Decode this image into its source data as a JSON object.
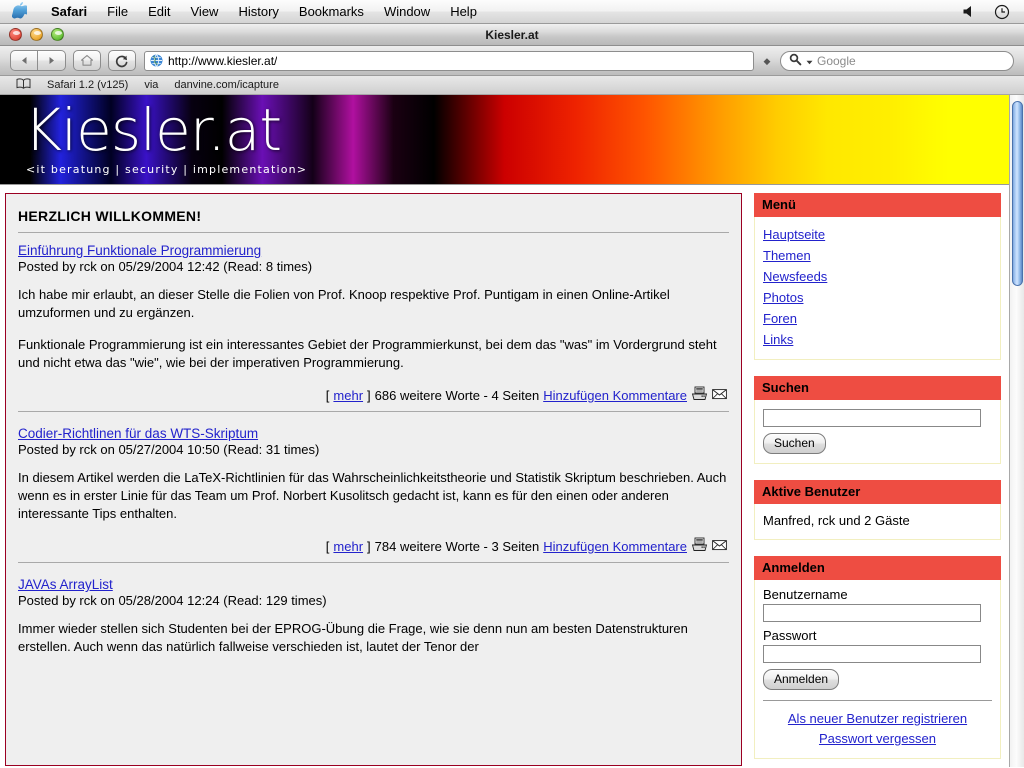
{
  "menubar": {
    "apple_icon": "apple-logo-icon",
    "items": [
      "Safari",
      "File",
      "Edit",
      "View",
      "History",
      "Bookmarks",
      "Window",
      "Help"
    ],
    "right_icons": [
      "volume-icon",
      "clock-icon"
    ]
  },
  "window": {
    "title": "Kiesler.at"
  },
  "toolbar": {
    "back_icon": "back-arrow-icon",
    "forward_icon": "forward-arrow-icon",
    "home_icon": "home-icon",
    "reload_icon": "reload-icon",
    "favicon": "globe-icon",
    "url": "http://www.kiesler.at/",
    "snapback_icon": "snapback-icon",
    "search_icon": "magnifier-icon",
    "search_placeholder": "Google"
  },
  "bookmarks_bar": {
    "book_icon": "book-icon",
    "items": [
      "Safari 1.2 (v125)",
      "via",
      "danvine.com/icapture"
    ]
  },
  "banner": {
    "logo": "Kiesler.at",
    "tagline": "<it beratung | security | implementation>"
  },
  "content": {
    "heading": "HERZLICH WILLKOMMEN!",
    "articles": [
      {
        "title": "Einführung Funktionale Programmierung",
        "meta": "Posted by rck on 05/29/2004 12:42 (Read: 8 times)",
        "para1": "Ich habe mir erlaubt, an dieser Stelle die Folien von Prof. Knoop respektive Prof. Puntigam in einen Online-Artikel umzuformen und zu ergänzen.",
        "para2": "Funktionale Programmierung ist ein interessantes Gebiet der Programmierkunst, bei dem das \"was\" im Vordergrund steht und nicht etwa das \"wie\", wie bei der imperativen Programmierung.",
        "more_label": "mehr",
        "more_text": "686 weitere Worte - 4 Seiten",
        "comments_label": "Hinzufügen Kommentare",
        "print_icon": "printer-icon",
        "mail_icon": "envelope-icon"
      },
      {
        "title": "Codier-Richtlinen für das WTS-Skriptum",
        "meta": "Posted by rck on 05/27/2004 10:50 (Read: 31 times)",
        "para1": "In diesem Artikel werden die LaTeX-Richtlinien für das Wahrscheinlichkeitstheorie und Statistik Skriptum beschrieben. Auch wenn es in erster Linie für das Team um Prof. Norbert Kusolitsch gedacht ist, kann es für den einen oder anderen interessante Tips enthalten.",
        "more_label": "mehr",
        "more_text": "784 weitere Worte - 3 Seiten",
        "comments_label": "Hinzufügen Kommentare",
        "print_icon": "printer-icon",
        "mail_icon": "envelope-icon"
      },
      {
        "title": "JAVAs ArrayList",
        "meta": "Posted by rck on 05/28/2004 12:24 (Read: 129 times)",
        "para1": "Immer wieder stellen sich Studenten bei der EPROG-Übung die Frage, wie sie denn nun am besten Datenstrukturen erstellen. Auch wenn das natürlich fallweise verschieden ist, lautet der Tenor der"
      }
    ]
  },
  "sidebar": {
    "menu": {
      "title": "Menü",
      "items": [
        "Hauptseite",
        "Themen",
        "Newsfeeds",
        "Photos",
        "Foren",
        "Links"
      ]
    },
    "search": {
      "title": "Suchen",
      "input_value": "",
      "button_label": "Suchen"
    },
    "active_users": {
      "title": "Aktive Benutzer",
      "text": "Manfred, rck und 2 Gäste"
    },
    "login": {
      "title": "Anmelden",
      "username_label": "Benutzername",
      "username_value": "",
      "password_label": "Passwort",
      "password_value": "",
      "button_label": "Anmelden",
      "register_link": "Als neuer Benutzer registrieren",
      "forgot_link": "Passwort vergessen"
    }
  },
  "colors": {
    "accent_red": "#EE4D42",
    "box_border": "#9B0022",
    "link_blue": "#2222CC",
    "content_bg": "#EFEFEF"
  }
}
